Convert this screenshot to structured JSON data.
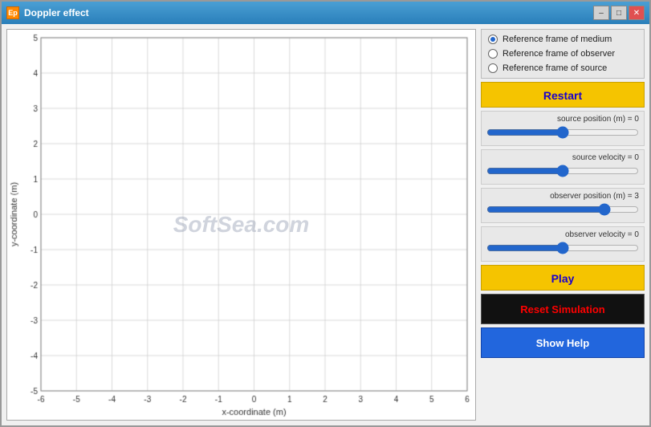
{
  "window": {
    "title": "Doppler effect",
    "icon": "Ep"
  },
  "titlebar": {
    "minimize_label": "–",
    "maximize_label": "□",
    "close_label": "✕"
  },
  "radio_group": {
    "options": [
      {
        "id": "medium",
        "label": "Reference frame of medium",
        "selected": true
      },
      {
        "id": "observer",
        "label": "Reference frame of observer",
        "selected": false
      },
      {
        "id": "source",
        "label": "Reference frame of source",
        "selected": false
      }
    ]
  },
  "buttons": {
    "restart": "Restart",
    "play": "Play",
    "reset_simulation": "Reset Simulation",
    "show_help": "Show Help"
  },
  "sliders": {
    "source_position": {
      "label": "source position (m) = 0",
      "value": 50,
      "min": 0,
      "max": 100
    },
    "source_velocity": {
      "label": "source velocity = 0",
      "value": 50,
      "min": 0,
      "max": 100
    },
    "observer_position": {
      "label": "observer position (m) = 3",
      "value": 80,
      "min": 0,
      "max": 100
    },
    "observer_velocity": {
      "label": "observer velocity = 0",
      "value": 50,
      "min": 0,
      "max": 100
    }
  },
  "plot": {
    "x_label": "x-coordinate (m)",
    "y_label": "y-coordinate (m)",
    "x_range": [
      -6,
      6
    ],
    "y_range": [
      -5,
      5
    ],
    "watermark": "SoftSea.com"
  }
}
